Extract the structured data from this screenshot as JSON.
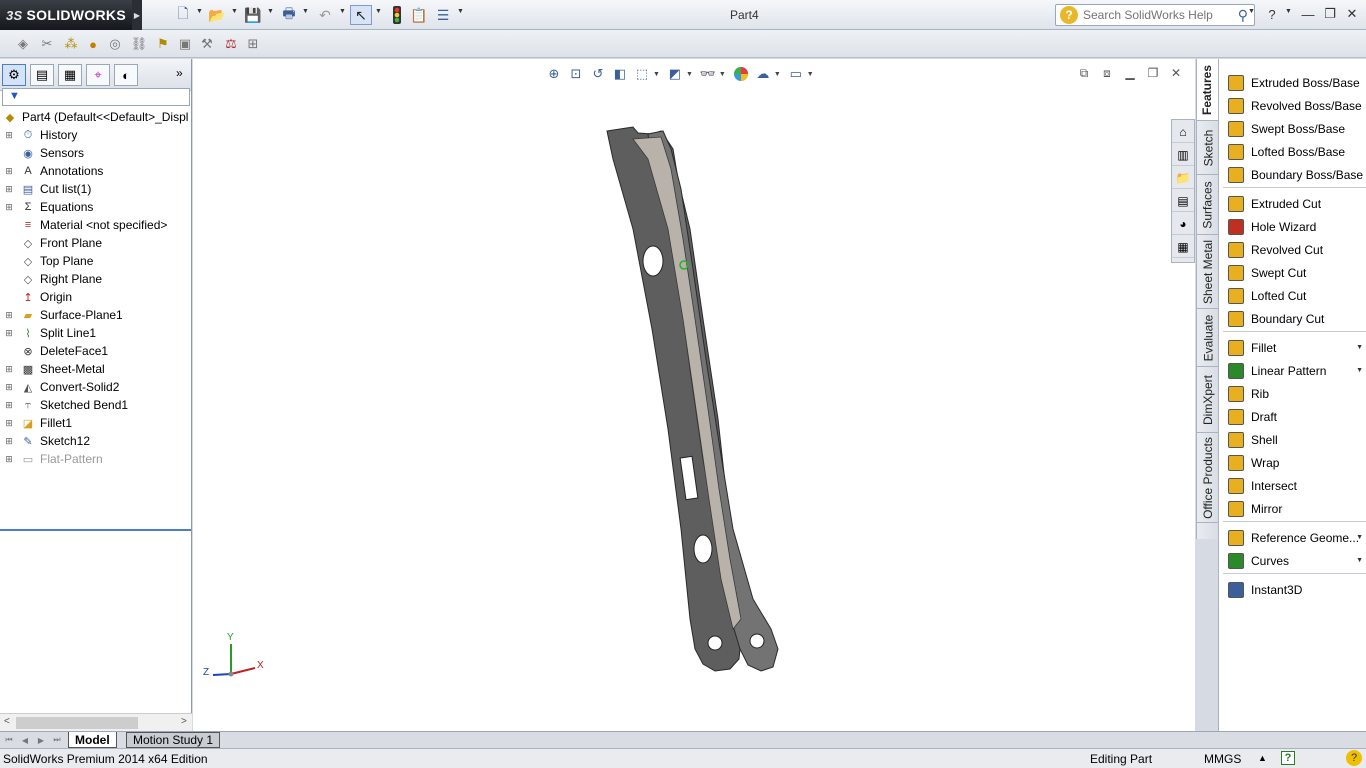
{
  "app": {
    "brand": "SOLIDWORKS",
    "brand_prefix": "3S",
    "document_title": "Part4"
  },
  "search": {
    "placeholder": "Search SolidWorks Help"
  },
  "feature_tree": {
    "root": "Part4  (Default<<Default>_Displ",
    "items": [
      {
        "label": "History",
        "icon": "history-icon",
        "expandable": true
      },
      {
        "label": "Sensors",
        "icon": "sensors-icon",
        "expandable": false
      },
      {
        "label": "Annotations",
        "icon": "annotations-icon",
        "expandable": true
      },
      {
        "label": "Cut list(1)",
        "icon": "cut-list-icon",
        "expandable": true
      },
      {
        "label": "Equations",
        "icon": "equations-icon",
        "expandable": true
      },
      {
        "label": "Material <not specified>",
        "icon": "material-icon",
        "expandable": false
      },
      {
        "label": "Front Plane",
        "icon": "plane-icon",
        "expandable": false
      },
      {
        "label": "Top Plane",
        "icon": "plane-icon",
        "expandable": false
      },
      {
        "label": "Right Plane",
        "icon": "plane-icon",
        "expandable": false
      },
      {
        "label": "Origin",
        "icon": "origin-icon",
        "expandable": false
      },
      {
        "label": "Surface-Plane1",
        "icon": "surface-plane-icon",
        "expandable": true
      },
      {
        "label": "Split Line1",
        "icon": "split-line-icon",
        "expandable": true
      },
      {
        "label": "DeleteFace1",
        "icon": "delete-face-icon",
        "expandable": false
      },
      {
        "label": "Sheet-Metal",
        "icon": "sheet-metal-icon",
        "expandable": true
      },
      {
        "label": "Convert-Solid2",
        "icon": "convert-solid-icon",
        "expandable": true
      },
      {
        "label": "Sketched Bend1",
        "icon": "sketched-bend-icon",
        "expandable": true
      },
      {
        "label": "Fillet1",
        "icon": "fillet-icon",
        "expandable": true
      },
      {
        "label": "Sketch12",
        "icon": "sketch-icon",
        "expandable": true
      },
      {
        "label": "Flat-Pattern",
        "icon": "flat-pattern-icon",
        "expandable": true,
        "suppressed": true
      }
    ]
  },
  "vertical_tabs": [
    "Features",
    "Sketch",
    "Surfaces",
    "Sheet Metal",
    "Evaluate",
    "DimXpert",
    "Office Products"
  ],
  "features": [
    {
      "label": "Extruded Boss/Base",
      "color": "#e8b020"
    },
    {
      "label": "Revolved Boss/Base",
      "color": "#e8b020"
    },
    {
      "label": "Swept Boss/Base",
      "color": "#e8b020"
    },
    {
      "label": "Lofted Boss/Base",
      "color": "#e8b020"
    },
    {
      "label": "Boundary Boss/Base",
      "color": "#e8b020"
    },
    {
      "label": "Extruded Cut",
      "color": "#e8b020"
    },
    {
      "label": "Hole Wizard",
      "color": "#c03020"
    },
    {
      "label": "Revolved Cut",
      "color": "#e8b020"
    },
    {
      "label": "Swept Cut",
      "color": "#e8b020"
    },
    {
      "label": "Lofted Cut",
      "color": "#e8b020"
    },
    {
      "label": "Boundary Cut",
      "color": "#e8b020"
    },
    {
      "label": "Fillet",
      "color": "#e8b020"
    },
    {
      "label": "Linear Pattern",
      "color": "#2a8a2a"
    },
    {
      "label": "Rib",
      "color": "#e8b020"
    },
    {
      "label": "Draft",
      "color": "#e8b020"
    },
    {
      "label": "Shell",
      "color": "#e8b020"
    },
    {
      "label": "Wrap",
      "color": "#e8b020"
    },
    {
      "label": "Intersect",
      "color": "#e8b020"
    },
    {
      "label": "Mirror",
      "color": "#e8b020"
    },
    {
      "label": "Reference Geome...",
      "color": "#e8b020"
    },
    {
      "label": "Curves",
      "color": "#2a8a2a"
    },
    {
      "label": "Instant3D",
      "color": "#3b5f9a"
    }
  ],
  "bottom_tabs": {
    "model": "Model",
    "motion": "Motion Study 1"
  },
  "status": {
    "edition": "SolidWorks Premium 2014 x64 Edition",
    "mode": "Editing Part",
    "units": "MMGS",
    "help": "?"
  },
  "triad": {
    "x": "X",
    "y": "Y",
    "z": "Z"
  }
}
